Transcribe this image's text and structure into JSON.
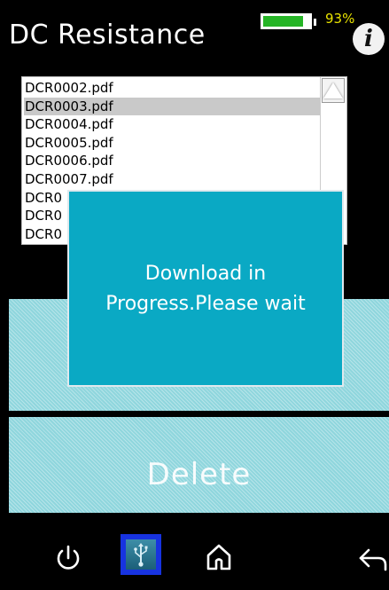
{
  "header": {
    "title": "DC Resistance",
    "battery_percent_text": "93%",
    "battery_level": 0.93,
    "info_label": "i"
  },
  "file_list": {
    "items": [
      {
        "name": "DCR0002.pdf",
        "selected": false
      },
      {
        "name": "DCR0003.pdf",
        "selected": true
      },
      {
        "name": "DCR0004.pdf",
        "selected": false
      },
      {
        "name": "DCR0005.pdf",
        "selected": false
      },
      {
        "name": "DCR0006.pdf",
        "selected": false
      },
      {
        "name": "DCR0007.pdf",
        "selected": false
      },
      {
        "name": "DCR0",
        "selected": false
      },
      {
        "name": "DCR0",
        "selected": false
      },
      {
        "name": "DCR0",
        "selected": false
      }
    ]
  },
  "actions": {
    "delete_label": "Delete"
  },
  "dialog": {
    "message": "Download in Progress.Please wait"
  },
  "bottom_nav": {
    "icons": [
      "power-icon",
      "usb-icon",
      "home-icon",
      "back-icon"
    ]
  },
  "colors": {
    "dialog_bg": "#0aa9c4",
    "button_bg": "#8fd6dd",
    "battery_fill": "#26b526",
    "battery_text": "#e8e200",
    "usb_highlight": "#1733e0"
  }
}
